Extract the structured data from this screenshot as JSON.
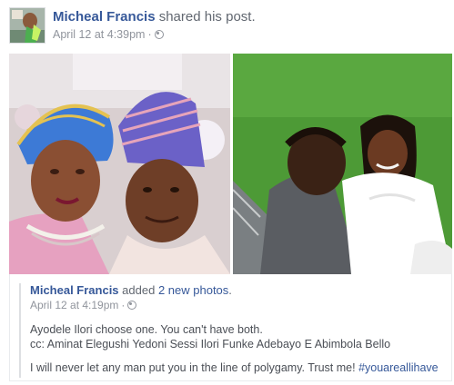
{
  "post": {
    "author": "Micheal Francis",
    "action": "shared his",
    "object": "post.",
    "timestamp": "April 12 at 4:39pm",
    "separator": "·",
    "privacy_icon": "globe-icon"
  },
  "photos": [
    {
      "subject": "selfie of a couple wearing purple and gold gele and cap"
    },
    {
      "subject": "bride and groom embracing on a green lawn"
    }
  ],
  "shared": {
    "author": "Micheal Francis",
    "action": "added",
    "link_text": "2 new photos",
    "period": ".",
    "timestamp": "April 12 at 4:19pm",
    "separator": "·",
    "privacy_icon": "globe-icon",
    "line1": "Ayodele Ilori choose one. You can't have both.",
    "line2": "cc: Aminat Elegushi Yedoni Sessi Ilori Funke Adebayo E Abimbola Bello",
    "line3_text": "I will never let any man put you in the line of polygamy. Trust me!",
    "hashtag": "#youareallihave"
  },
  "colors": {
    "link": "#365899",
    "meta": "#90949c",
    "body_text": "#4b4f56"
  }
}
